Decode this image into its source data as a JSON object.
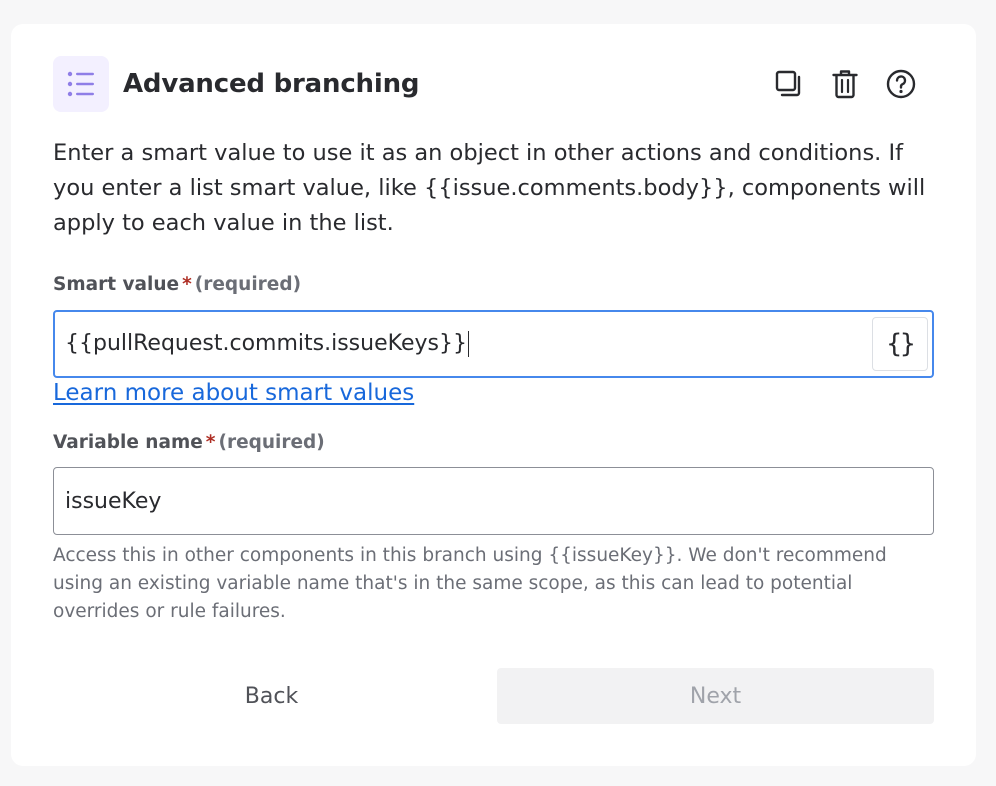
{
  "header": {
    "title": "Advanced branching",
    "icon": "list-icon",
    "accent_color": "#8f7ee7",
    "actions": [
      {
        "name": "duplicate-icon",
        "label": "Duplicate"
      },
      {
        "name": "trash-icon",
        "label": "Delete"
      },
      {
        "name": "help-icon",
        "label": "Help"
      }
    ]
  },
  "description": "Enter a smart value to use it as an object in other actions and conditions. If you enter a list smart value, like {{issue.comments.body}}, components will apply to each value in the list.",
  "smart_value": {
    "label": "Smart value",
    "required_star": "*",
    "required_text": "(required)",
    "value": "{{pullRequest.commits.issueKeys}}",
    "insert_button": "{}",
    "link_text": "Learn more about smart values"
  },
  "variable_name": {
    "label": "Variable name",
    "required_star": "*",
    "required_text": "(required)",
    "value": "issueKey",
    "help": "Access this in other components in this branch using {{issueKey}}. We don't recommend using an existing variable name that's in the same scope, as this can lead to potential overrides or rule failures."
  },
  "footer": {
    "back_label": "Back",
    "next_label": "Next"
  }
}
